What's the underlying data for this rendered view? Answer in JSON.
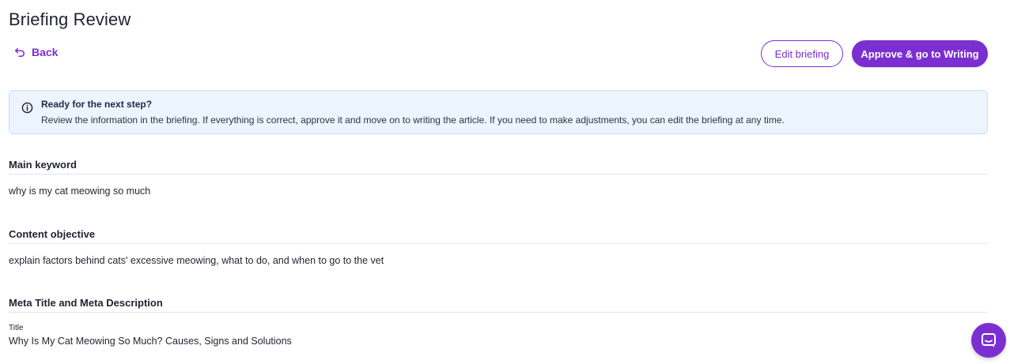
{
  "header": {
    "title": "Briefing Review",
    "back_label": "Back",
    "edit_label": "Edit briefing",
    "approve_label": "Approve & go to Writing"
  },
  "info": {
    "title": "Ready for the next step?",
    "text": "Review the information in the briefing. If everything is correct, approve it and move on to writing the article. If you need to make adjustments, you can edit the briefing at any time."
  },
  "sections": {
    "keyword": {
      "heading": "Main keyword",
      "value": "why is my cat meowing so much"
    },
    "objective": {
      "heading": "Content objective",
      "value": "explain factors behind cats' excessive meowing, what to do, and when to go to the vet"
    },
    "meta": {
      "heading": "Meta Title and Meta Description",
      "title_label": "Title",
      "title_value": "Why Is My Cat Meowing So Much? Causes, Signs and Solutions"
    }
  },
  "colors": {
    "accent": "#7b2fd1",
    "info_bg": "#ecf4fd",
    "info_border": "#c8def5"
  },
  "icons": {
    "back": "undo-arrow-icon",
    "info": "info-circle-icon",
    "chat": "chat-icon"
  }
}
